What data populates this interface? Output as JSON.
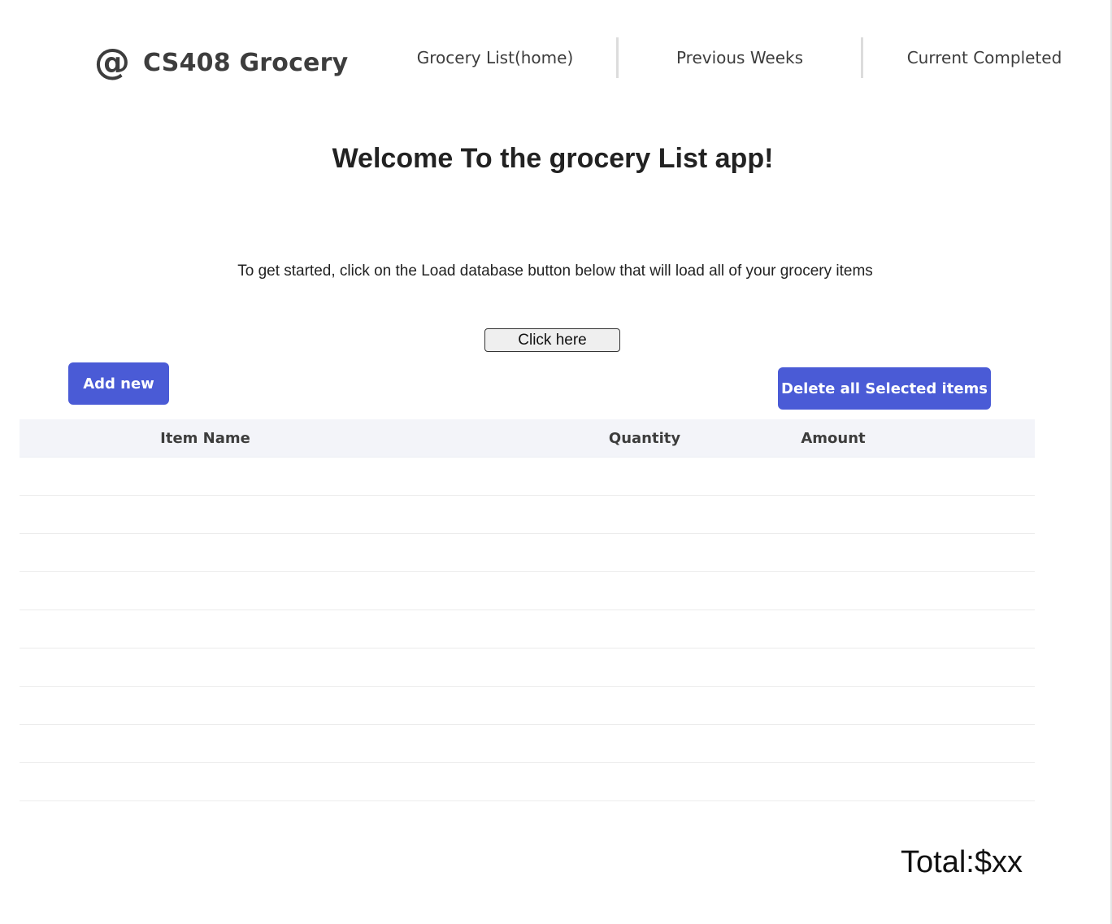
{
  "brand": {
    "icon": "@",
    "title": "CS408 Grocery"
  },
  "nav": {
    "items": [
      {
        "label": "Grocery List(home)"
      },
      {
        "label": "Previous Weeks"
      },
      {
        "label": "Current Completed"
      }
    ]
  },
  "main": {
    "title": "Welcome To the grocery List app!",
    "instructions": "To get started, click on the Load database button below that will load all of your grocery items",
    "load_button_label": "Click here"
  },
  "actions": {
    "add_label": "Add new",
    "delete_label": "Delete all Selected items"
  },
  "table": {
    "columns": [
      "Item Name",
      "Quantity",
      "Amount"
    ],
    "rows": []
  },
  "footer": {
    "total_label": "Total:$xx"
  },
  "colors": {
    "accent": "#4a5bd6",
    "header_bg": "#f3f4f9",
    "text": "#3d3d3d"
  }
}
